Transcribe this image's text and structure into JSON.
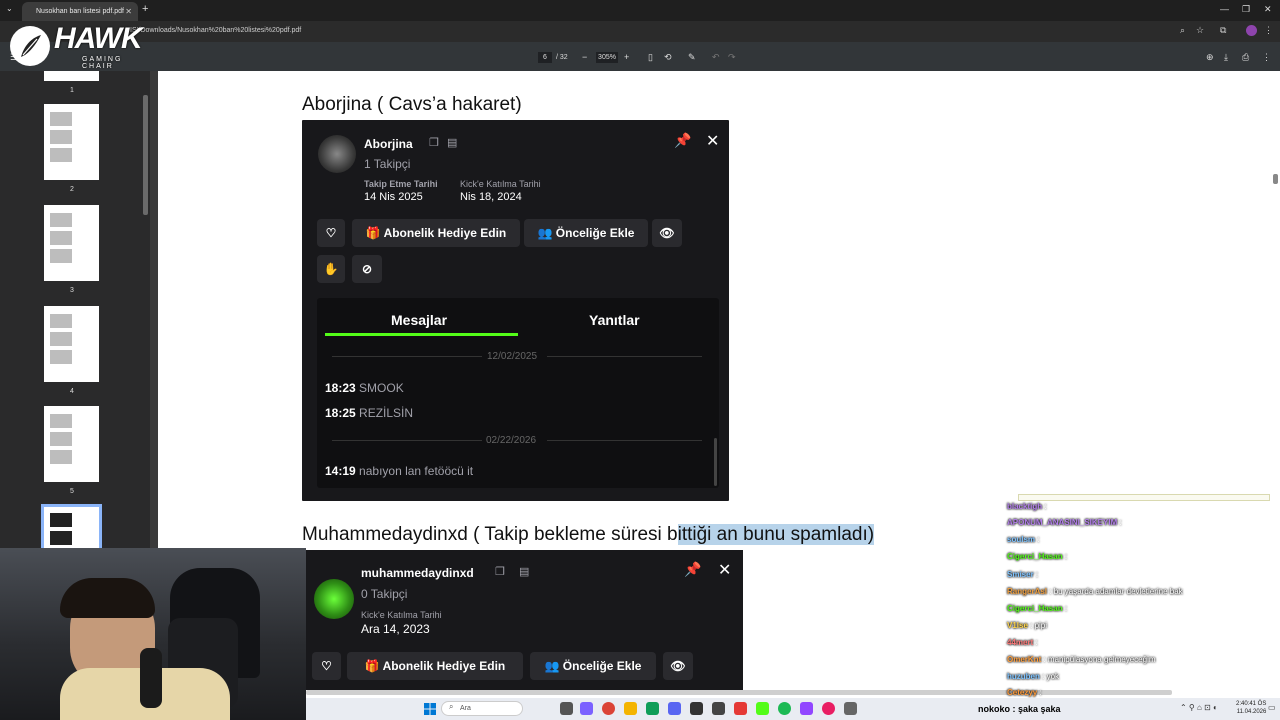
{
  "browser": {
    "tab_title": "Nusokhan ban listesi pdf.pdf",
    "url": "ISI/Downloads/Nusokhan%20ban%20listesi%20pdf.pdf"
  },
  "pdf_toolbar": {
    "current_page": "6",
    "total_pages": "/ 32",
    "zoom": "305%"
  },
  "logo": {
    "name": "HAWK",
    "tagline": "GAMING CHAIR"
  },
  "sidebar": {
    "thumbnails": [
      "1",
      "2",
      "3",
      "4",
      "5"
    ]
  },
  "page": {
    "heading1": "Aborjina ( Cavs’a hakaret)",
    "heading2_part1": "Muhammedaydinxd ( Takip bekleme süresi b",
    "heading2_part2": "ittiği an bunu spamladı)"
  },
  "card1": {
    "username": "Aborjina",
    "followers": "1 Takipçi",
    "follow_date_label": "Takip Etme Tarihi",
    "follow_date": "14 Nis 2025",
    "join_date_label": "Kick'e Katılma Tarihi",
    "join_date": "Nis 18, 2024",
    "gift_sub_label": "Abonelik Hediye Edin",
    "priority_label": "Önceliğe Ekle",
    "tabs": [
      "Mesajlar",
      "Yanıtlar"
    ],
    "messages": [
      {
        "type": "date",
        "text": "12/02/2025"
      },
      {
        "type": "msg",
        "time": "18:23",
        "text": "SMOOK"
      },
      {
        "type": "msg",
        "time": "18:25",
        "text": "REZİLSİN"
      },
      {
        "type": "date",
        "text": "02/22/2026"
      },
      {
        "type": "msg",
        "time": "14:19",
        "text": "nabıyon lan fetööcü it"
      }
    ]
  },
  "card2": {
    "username": "muhammedaydinxd",
    "followers": "0 Takipçi",
    "join_date_label": "Kick'e Katılma Tarihi",
    "join_date": "Ara 14, 2023",
    "gift_sub_label": "Abonelik Hediye Edin",
    "priority_label": "Önceliğe Ekle"
  },
  "chat": {
    "lines": [
      {
        "user": "blacktigh",
        "msg": ""
      },
      {
        "user": "APONUM_ANASINI_SIKEYIM",
        "msg": ""
      },
      {
        "user": "soulsm",
        "msg": ""
      },
      {
        "user": "Cigerci_Hasan",
        "msg": ""
      },
      {
        "user": "Smiser",
        "msg": ""
      },
      {
        "user": "RangerAsl",
        "msg": "bu yaşarda adamlar devletlerine bak"
      },
      {
        "user": "Cigerci_Hasan",
        "msg": ""
      },
      {
        "user": "V1lse",
        "msg": "pipi"
      },
      {
        "user": "44mert",
        "msg": ""
      },
      {
        "user": "OmerKnt",
        "msg": "manipülasyona gelmeyeceğim"
      },
      {
        "user": "huzuben",
        "msg": "yok"
      },
      {
        "user": "Cetezyy",
        "msg": ""
      }
    ],
    "bottom_line": "nokoko : şaka şaka"
  },
  "taskbar": {
    "search_placeholder": "Ara",
    "time": "2:40:41 ÖS",
    "date": "11.04.2026"
  },
  "colors": {
    "kick_green": "#53fc18",
    "card_bg": "#18181b",
    "pdf_toolbar": "#323639",
    "highlight": "#b7d3ea"
  }
}
